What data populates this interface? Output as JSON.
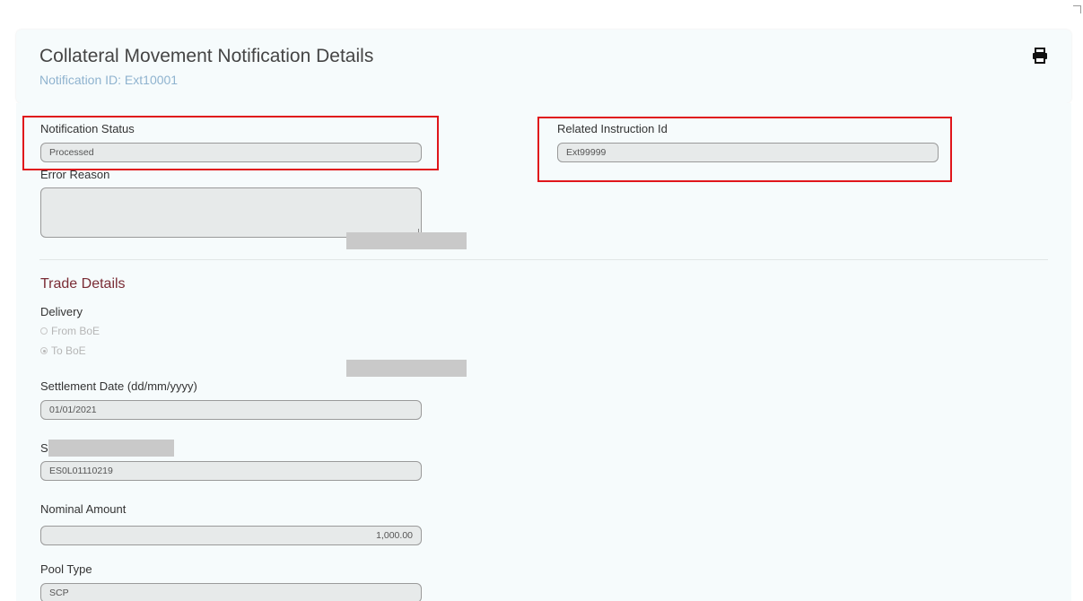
{
  "header": {
    "title": "Collateral Movement Notification Details",
    "notification_id": "Notification ID: Ext10001"
  },
  "icons": {
    "print": "print-icon"
  },
  "colors": {
    "highlight": "#e0161b",
    "section_title": "#7a2c35",
    "subtitle": "#8fb3cf"
  },
  "fields": {
    "notification_status": {
      "label": "Notification Status",
      "value": "Processed"
    },
    "related_instruction_id": {
      "label": "Related Instruction Id",
      "value": "Ext99999"
    },
    "error_reason": {
      "label": "Error Reason",
      "value": ""
    }
  },
  "trade_details": {
    "section_title": "Trade Details",
    "delivery": {
      "label": "Delivery",
      "options": [
        {
          "label": "From BoE",
          "checked": false
        },
        {
          "label": "To BoE",
          "checked": true
        }
      ]
    },
    "settlement_date": {
      "label": "Settlement Date (dd/mm/yyyy)",
      "value": "01/01/2021"
    },
    "security": {
      "label": "S",
      "value": "ES0L01110219"
    },
    "nominal_amount": {
      "label": "Nominal Amount",
      "value": "1,000.00"
    },
    "pool_type": {
      "label": "Pool Type",
      "value": "SCP"
    }
  }
}
